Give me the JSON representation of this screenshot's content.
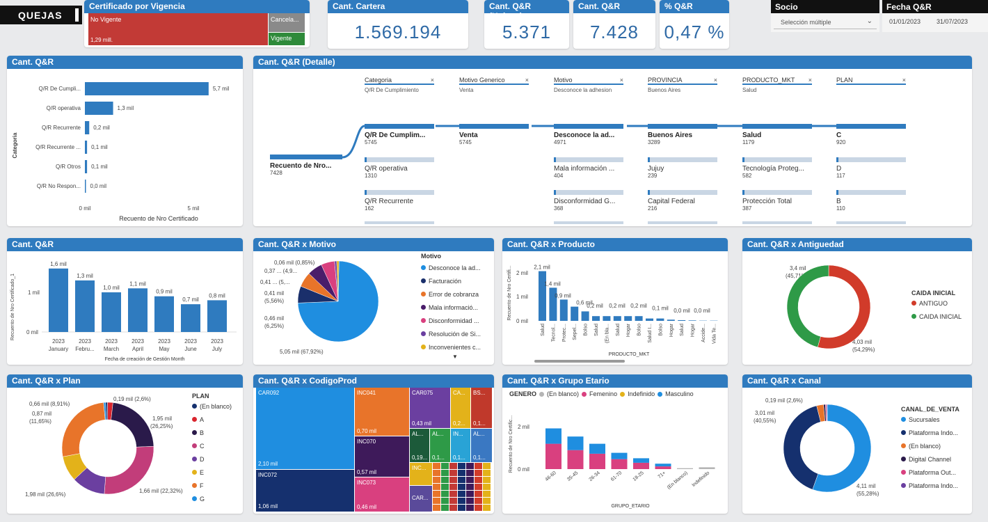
{
  "header": {
    "title": "QUEJAS",
    "vigencia": {
      "title": "Certificado por Vigencia",
      "no_vigente": "No Vigente",
      "no_vigente_value": "1,29 mill.",
      "cancelado": "Cancela...",
      "vigente": "Vigente"
    },
    "kpis": [
      {
        "title": "Cant. Cartera",
        "value": "1.569.194"
      },
      {
        "title": "Cant. Q&R (Unicos)",
        "value": "5.371"
      },
      {
        "title": "Cant. Q&R",
        "value": "7.428"
      },
      {
        "title": "% Q&R",
        "value": "0,47 %"
      }
    ],
    "socio": {
      "title": "Socio",
      "value": "Selección múltiple"
    },
    "fecha": {
      "title": "Fecha Q&R",
      "from": "01/01/2023",
      "to": "31/07/2023"
    }
  },
  "panels": {
    "categoria": {
      "title": "Cant. Q&R",
      "ylabel": "Categoria",
      "xlabel": "Recuento de Nro Certificado",
      "ticks": [
        "0 mil",
        "5 mil"
      ],
      "labels": [
        "0,2 mil",
        "1,3 mil",
        "0,2 mil",
        "0,1 mil",
        "0,1 mil",
        "0,0 mil"
      ]
    },
    "detalle": {
      "title": "Cant. Q&R (Detalle)",
      "root": {
        "label": "Recuento de Nro...",
        "value": "7428"
      },
      "columns": [
        {
          "header": "Categoria",
          "filter": "Q/R De Cumplimiento",
          "nodes": [
            {
              "label": "Q/R De Cumplim...",
              "value": "5745"
            },
            {
              "label": "Q/R operativa",
              "value": "1310"
            },
            {
              "label": "Q/R Recurrente",
              "value": "162"
            }
          ]
        },
        {
          "header": "Motivo Generico",
          "filter": "Venta",
          "nodes": [
            {
              "label": "Venta",
              "value": "5745"
            }
          ]
        },
        {
          "header": "Motivo",
          "filter": "Desconoce la adhesion",
          "nodes": [
            {
              "label": "Desconoce la ad...",
              "value": "4971"
            },
            {
              "label": "Mala información ...",
              "value": "404"
            },
            {
              "label": "Disconformidad G...",
              "value": "368"
            }
          ]
        },
        {
          "header": "PROVINCIA",
          "filter": "Buenos Aires",
          "nodes": [
            {
              "label": "Buenos Aires",
              "value": "3289"
            },
            {
              "label": "Jujuy",
              "value": "239"
            },
            {
              "label": "Capital Federal",
              "value": "216"
            }
          ]
        },
        {
          "header": "PRODUCTO_MKT",
          "filter": "Salud",
          "nodes": [
            {
              "label": "Salud",
              "value": "1179"
            },
            {
              "label": "Tecnología Proteg...",
              "value": "582"
            },
            {
              "label": "Protección Total",
              "value": "387"
            }
          ]
        },
        {
          "header": "PLAN",
          "filter": "",
          "nodes": [
            {
              "label": "C",
              "value": "920"
            },
            {
              "label": "D",
              "value": "117"
            },
            {
              "label": "B",
              "value": "110"
            }
          ]
        }
      ]
    },
    "mensual": {
      "title": "Cant. Q&R",
      "ylabel": "Recuento de Nro Certificado_1",
      "xlabel": "Fecha de creación de Gestión Month",
      "yticks": [
        "1 mil",
        "0 mil"
      ],
      "labels": [
        "1,6 mil",
        "1,3 mil",
        "1,0 mil",
        "1,1 mil",
        "0,9 mil",
        "0,7 mil",
        "0,8 mil"
      ],
      "years": [
        "2023",
        "2023",
        "2023",
        "2023",
        "2023",
        "2023",
        "2023"
      ]
    },
    "motivo": {
      "title": "Cant. Q&R x Motivo",
      "legend_title": "Motivo",
      "labels": [
        "0,06 mil (0,85%)",
        "0,37 ... (4,9...",
        "0,41 ... (5,...",
        "0,41 mil",
        "(5,56%)",
        "0,46 mil",
        "(6,25%)",
        "5,05 mil (67,92%)"
      ]
    },
    "producto": {
      "title": "Cant. Q&R x Producto",
      "ylabel": "Recuento de Nro Certifi...",
      "xlabel": "PRODUCTO_MKT",
      "yticks": [
        "2 mil",
        "1 mil",
        "0 mil"
      ],
      "value_labels": [
        "2,1 mil",
        "1,4 mil",
        "0,9 mil",
        "0,6 mil",
        "0,2 mil",
        "0,2 mil",
        "0,2 mil",
        "0,1 mil",
        "0,0 mil",
        "0,0 mil"
      ]
    },
    "antiguedad": {
      "title": "Cant. Q&R x Antiguedad",
      "legend_title": "CAIDA INICIAL",
      "label_a": "3,4 mil",
      "label_a_pct": "(45,71%)",
      "label_b": "4,03 mil",
      "label_b_pct": "(54,29%)"
    },
    "plan": {
      "title": "Cant. Q&R x Plan",
      "legend_title": "PLAN",
      "labels": [
        "0,66 mil (8,91%)",
        "0,87 mil",
        "(11,65%)",
        "0,19 mil (2,6%)",
        "1,95 mil",
        "(26,25%)",
        "1,98 mil (26,6%)",
        "1,66 mil (22,32%)"
      ]
    },
    "codigo": {
      "title": "Cant. Q&R x CodigoProd",
      "val_car092": "2,10 mil",
      "val_inc072": "1,06 mil",
      "val_inc041": "0,70 mil",
      "val_car075": "0,43 mil",
      "val_inc070": "0,57 mil",
      "val_inc073": "0,46 mil",
      "tiny": [
        "CA...",
        "BS...",
        "0,2...",
        "0,1...",
        "AL...",
        "AL...",
        "IN...",
        "AL...",
        "0,19...",
        "0,1...",
        "0,1...",
        "0,1...",
        "INC...",
        "CAR..."
      ]
    },
    "grupo": {
      "title": "Cant. Q&R x Grupo Etario",
      "legend_title": "GENERO",
      "ylabel": "Recuento de Nro Certific...",
      "xlabel": "GRUPO_ETARIO",
      "yticks": [
        "2 mil",
        "0 mil"
      ]
    },
    "canal": {
      "title": "Cant. Q&R x Canal",
      "legend_title": "CANAL_DE_VENTA",
      "label_a": "0,19 mil (2,6%)",
      "label_b": "3,01 mil",
      "label_b_pct": "(40,55%)",
      "label_c": "4,11 mil",
      "label_c_pct": "(55,28%)"
    }
  },
  "chart_data": [
    {
      "type": "bar",
      "orientation": "horizontal",
      "title": "Cant. Q&R",
      "ylabel": "Categoria",
      "xlabel": "Recuento de Nro Certificado",
      "categories": [
        "Q/R De Cumpli...",
        "Q/R operativa",
        "Q/R Recurrente",
        "Q/R Recurrente ...",
        "Q/R Otros",
        "Q/R No Respon..."
      ],
      "values": [
        5.7,
        1.3,
        0.2,
        0.1,
        0.1,
        0.0
      ],
      "xlim": [
        0,
        6
      ]
    },
    {
      "type": "bar",
      "title": "Cant. Q&R",
      "xlabel": "Fecha de creación de Gestión Month",
      "ylabel": "Recuento de Nro Certificado_1",
      "categories": [
        "January",
        "Febru...",
        "March",
        "April",
        "May",
        "June",
        "July"
      ],
      "values": [
        1.6,
        1.3,
        1.0,
        1.1,
        0.9,
        0.7,
        0.8
      ],
      "ylim": [
        0,
        1.8
      ]
    },
    {
      "type": "pie",
      "title": "Cant. Q&R x Motivo",
      "categories": [
        "Desconoce la ad...",
        "Facturación",
        "Error de cobranza",
        "Mala informació...",
        "Disconformidad ...",
        "Resolución de Si...",
        "Inconvenientes c..."
      ],
      "values": [
        5.05,
        0.46,
        0.41,
        0.41,
        0.37,
        0.06,
        0.06
      ],
      "colors": [
        "#1f8ee0",
        "#1a2f6b",
        "#e8742a",
        "#4a1d6a",
        "#d9407f",
        "#6a3fa0",
        "#e3b21a"
      ]
    },
    {
      "type": "bar",
      "title": "Cant. Q&R x Producto",
      "xlabel": "PRODUCTO_MKT",
      "ylabel": "Recuento de Nro Certifi...",
      "categories": [
        "Salud",
        "Tecnol...",
        "Protec...",
        "Sepel...",
        "Bolso",
        "Salud",
        "(En bla...",
        "Salud",
        "Hogar",
        "Bolso",
        "Salud I...",
        "Bolso",
        "Hogar",
        "Salud",
        "Hogar",
        "Accide...",
        "Vida Te..."
      ],
      "values": [
        2.1,
        1.4,
        0.9,
        0.6,
        0.4,
        0.2,
        0.2,
        0.2,
        0.2,
        0.2,
        0.1,
        0.1,
        0.05,
        0.03,
        0.02,
        0.01,
        0.01
      ],
      "ylim": [
        0,
        2.4
      ]
    },
    {
      "type": "pie",
      "title": "Cant. Q&R x Antiguedad",
      "categories": [
        "ANTIGUO",
        "CAIDA INICIAL"
      ],
      "values": [
        4.03,
        3.4
      ],
      "colors": [
        "#d13b2a",
        "#2e9a47"
      ]
    },
    {
      "type": "pie",
      "title": "Cant. Q&R x Plan",
      "categories": [
        "(En blanco)",
        "A",
        "B",
        "C",
        "D",
        "E",
        "F",
        "G"
      ],
      "values": [
        0.05,
        0.14,
        1.66,
        1.98,
        0.87,
        0.66,
        1.95,
        0.05
      ],
      "colors": [
        "#15306e",
        "#d9252e",
        "#2a1a4a",
        "#c23d7a",
        "#6b3fa0",
        "#e3b21a",
        "#e8742a",
        "#1f8ee0"
      ]
    },
    {
      "type": "treemap",
      "title": "Cant. Q&R x CodigoProd",
      "categories": [
        "CAR092",
        "INC072",
        "INC041",
        "INC070",
        "INC073",
        "CAR075"
      ],
      "values": [
        2.1,
        1.06,
        0.7,
        0.57,
        0.46,
        0.43
      ]
    },
    {
      "type": "bar",
      "stacked": true,
      "title": "Cant. Q&R x Grupo Etario",
      "xlabel": "GRUPO_ETARIO",
      "ylabel": "Recuento de Nro Certific...",
      "categories": [
        "46-60",
        "35-45",
        "26-34",
        "61-70",
        "18-25",
        "71+",
        "(En blanco)",
        "Indefinido"
      ],
      "series": [
        {
          "name": "(En blanco)",
          "values": [
            0,
            0,
            0,
            0,
            0,
            0,
            0.05,
            0.1
          ],
          "color": "#b5b5b5"
        },
        {
          "name": "Femenino",
          "values": [
            1.4,
            1.05,
            0.85,
            0.55,
            0.35,
            0.15,
            0,
            0
          ],
          "color": "#d9407f"
        },
        {
          "name": "Indefinido",
          "values": [
            0,
            0,
            0,
            0,
            0,
            0,
            0,
            0
          ],
          "color": "#e3b21a"
        },
        {
          "name": "Masculino",
          "values": [
            0.85,
            0.75,
            0.55,
            0.35,
            0.25,
            0.15,
            0,
            0
          ],
          "color": "#1f8ee0"
        }
      ],
      "ylim": [
        0,
        2.8
      ]
    },
    {
      "type": "pie",
      "title": "Cant. Q&R x Canal",
      "categories": [
        "Sucursales",
        "Plataforma Indo...",
        "(En blanco)",
        "Digital Channel",
        "Plataforma Out...",
        "Plataforma Indo..."
      ],
      "values": [
        4.11,
        3.01,
        0.19,
        0.05,
        0.03,
        0.02
      ],
      "colors": [
        "#1f8ee0",
        "#15306e",
        "#e8742a",
        "#2a1a4a",
        "#d9407f",
        "#6b3fa0"
      ]
    }
  ]
}
